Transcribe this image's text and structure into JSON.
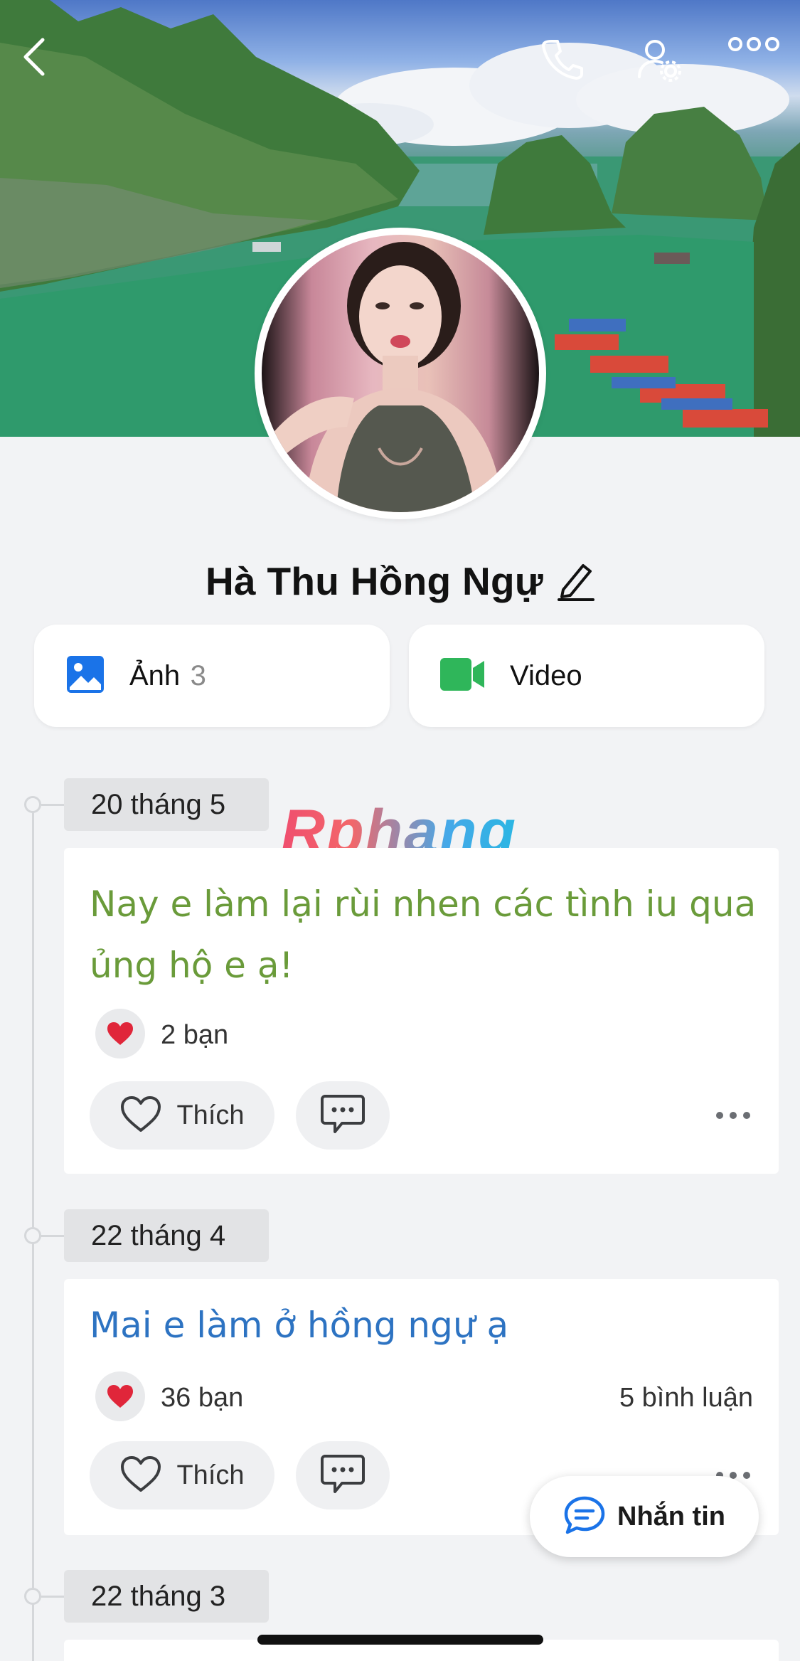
{
  "profile": {
    "name": "Hà Thu Hồng Ngự"
  },
  "icons": {
    "back": "chevron-left-icon",
    "call": "phone-icon",
    "settings": "user-settings-icon",
    "more": "more-horizontal-icon",
    "edit": "pencil-icon",
    "photo": "image-icon",
    "video": "video-camera-icon",
    "heart": "heart-icon",
    "like": "heart-outline-icon",
    "comment": "comment-icon",
    "message": "message-icon"
  },
  "media_tabs": {
    "photos_label": "Ảnh",
    "photos_count": "3",
    "video_label": "Video"
  },
  "watermark": "Rphang",
  "timeline": [
    {
      "date": "20 tháng 5",
      "text": "Nay e làm lại rùi nhen các tình iu qua ủng hộ e ạ!",
      "text_color": "#6a9b3a",
      "reactions": "2 bạn",
      "comments": "",
      "like_label": "Thích"
    },
    {
      "date": "22 tháng 4",
      "text": "Mai e làm ở hồng ngự ạ",
      "text_color": "#2d73c2",
      "reactions": "36 bạn",
      "comments": "5 bình luận",
      "like_label": "Thích"
    },
    {
      "date": "22 tháng 3"
    }
  ],
  "message_button": {
    "label": "Nhắn tin"
  },
  "colors": {
    "background": "#f2f3f5",
    "card": "#ffffff",
    "accent_blue": "#1a73e8",
    "video_green": "#2fb65a",
    "heart_red": "#e0263a"
  }
}
